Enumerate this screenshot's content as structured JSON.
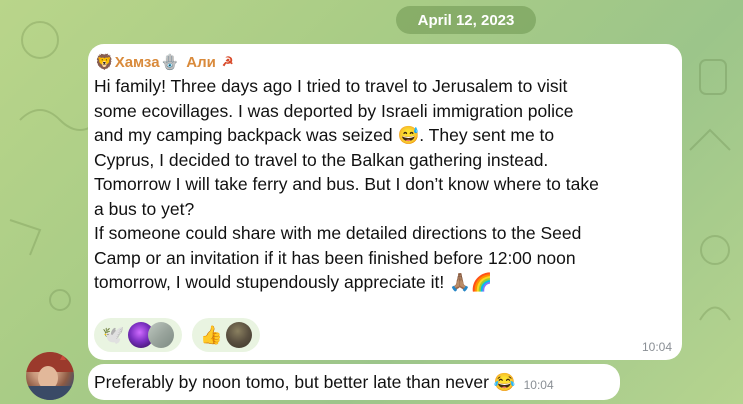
{
  "chat": {
    "date_label": "April 12, 2023"
  },
  "message1": {
    "sender_name": "Хамза",
    "sender_suffix": "Али",
    "text": "Hi family! Three days ago I tried to travel to Jerusalem to visit\nsome ecovillages. I was deported by Israeli immigration police\nand my camping backpack was seized 😅. They sent me to\nCyprus, I decided to travel to the Balkan gathering instead.\nTomorrow I will take ferry and bus. But I don’t know where to take\na bus to yet?\nIf someone could share with me detailed directions to the Seed\nCamp or an invitation if it has been finished before 12:00 noon\ntomorrow, I would stupendously appreciate it! 🙏🏽🌈",
    "time": "10:04",
    "reactions": [
      {
        "emoji": "🕊️"
      },
      {
        "emoji": "👍"
      }
    ]
  },
  "message2": {
    "text": "Preferably by noon tomo, but better late than never 😂",
    "time": "10:04"
  },
  "colors": {
    "sender": "#d98a3b",
    "bubble": "#ffffff",
    "reaction_bg": "#e9f4e1",
    "date_pill": "#7d9f5c"
  },
  "icons": {
    "sender_emoji_1": "lion-face-icon",
    "sender_emoji_2": "hamsa-hand-icon",
    "sender_emoji_3": "hammer-sickle-icon"
  }
}
